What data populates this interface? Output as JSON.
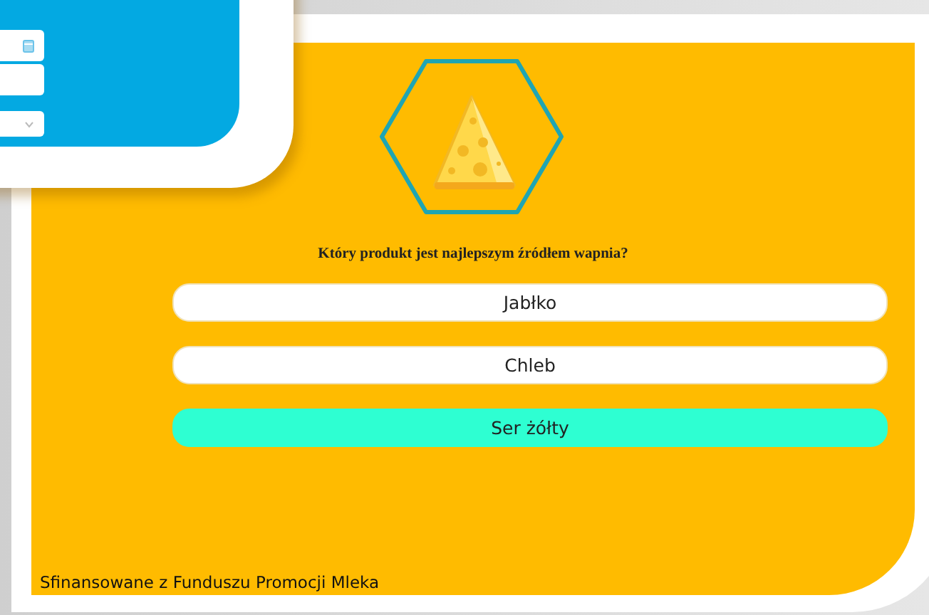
{
  "back_card": {
    "fields": [
      {
        "kind": "date"
      },
      {
        "kind": "text"
      },
      {
        "kind": "select"
      }
    ]
  },
  "quiz": {
    "question": "Który produkt jest najlepszym źródłem wapnia?",
    "options": [
      {
        "label": "Jabłko",
        "selected": false
      },
      {
        "label": "Chleb",
        "selected": false
      },
      {
        "label": "Ser żółty",
        "selected": true
      }
    ],
    "footer": "Sfinansowane z Funduszu Promocji Mleka"
  }
}
